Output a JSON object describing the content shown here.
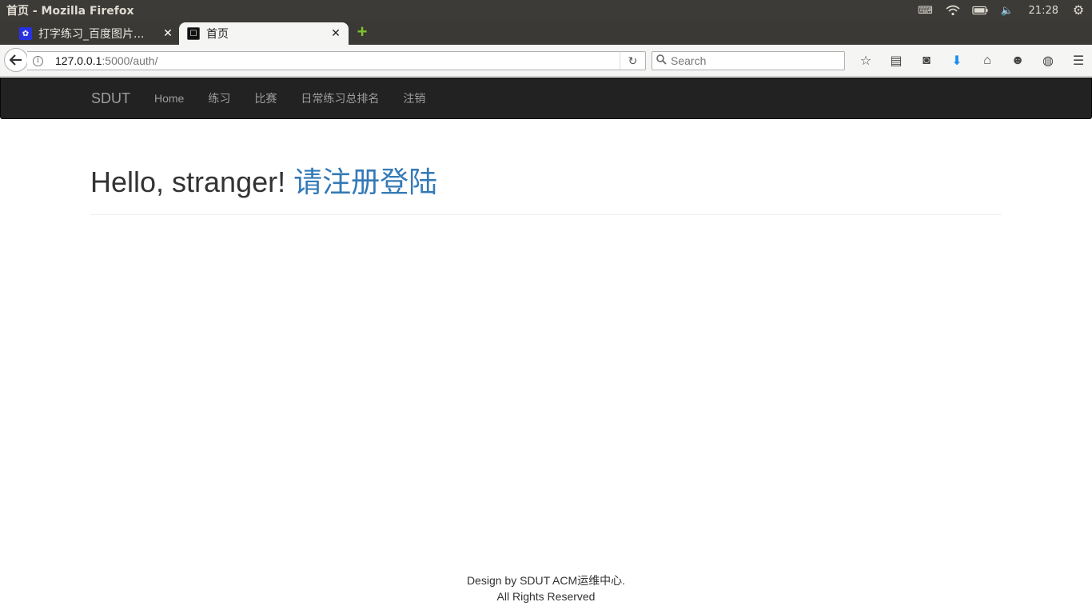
{
  "window": {
    "title": "首页 - Mozilla Firefox"
  },
  "tray": {
    "clock": "21:28",
    "icons": [
      "keyboard-icon",
      "wifi-icon",
      "battery-icon",
      "volume-icon",
      "settings-gear-icon"
    ]
  },
  "tabs": [
    {
      "label": "打字练习_百度图片...",
      "favicon": "baidu-icon"
    },
    {
      "label": "首页",
      "favicon": "site-favicon-icon"
    }
  ],
  "navbar": {
    "url_host": "127.0.0.1",
    "url_path": ":5000/auth/",
    "search_placeholder": "Search"
  },
  "site": {
    "brand": "SDUT",
    "nav_links": [
      "Home",
      "练习",
      "比赛",
      "日常练习总排名",
      "注销"
    ]
  },
  "header": {
    "greeting": "Hello, stranger!",
    "cta": "请注册登陆"
  },
  "footer": {
    "line1": "Design by SDUT ACM运维中心.",
    "line2": "All Rights Reserved"
  }
}
